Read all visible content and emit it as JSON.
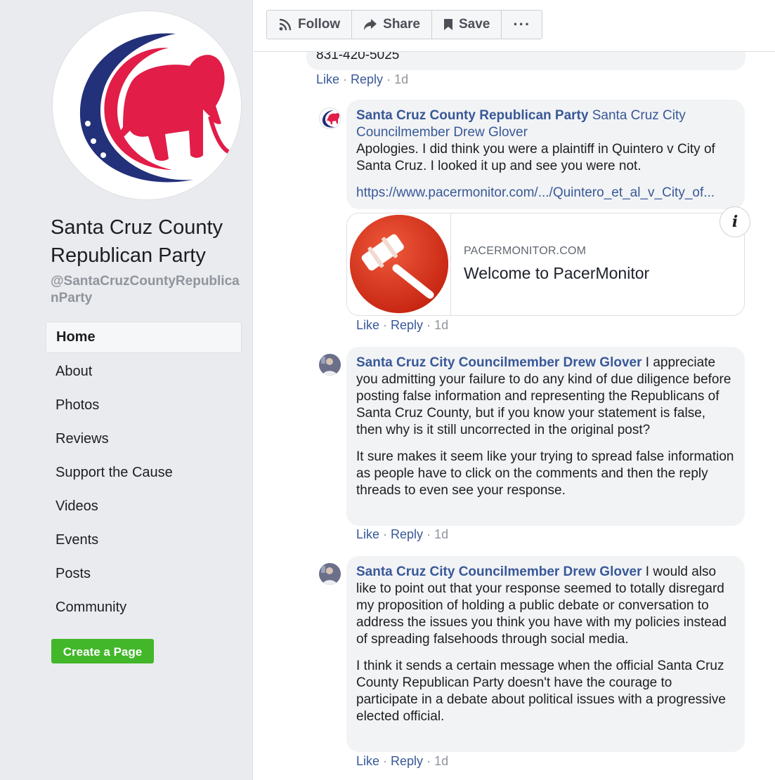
{
  "sidebar": {
    "page_name": "Santa Cruz County Republican Party",
    "page_handle": "@SantaCruzCountyRepublicanParty",
    "nav": [
      {
        "label": "Home",
        "active": true
      },
      {
        "label": "About"
      },
      {
        "label": "Photos"
      },
      {
        "label": "Reviews"
      },
      {
        "label": "Support the Cause"
      },
      {
        "label": "Videos"
      },
      {
        "label": "Events"
      },
      {
        "label": "Posts"
      },
      {
        "label": "Community"
      }
    ],
    "create_page_label": "Create a Page"
  },
  "toolbar": {
    "follow_label": "Follow",
    "share_label": "Share",
    "save_label": "Save",
    "more_label": "···"
  },
  "previous_comment": {
    "text_fragment": "831-420-5025",
    "like": "Like",
    "reply": "Reply",
    "time": "1d"
  },
  "comments": [
    {
      "author": "Santa Cruz County Republican Party",
      "mention": "Santa Cruz City Councilmember Drew Glover",
      "paragraphs": [
        "Apologies. I did think you were a plaintiff in Quintero v City of Santa Cruz. I looked it up and see you were not."
      ],
      "link": "https://www.pacermonitor.com/.../Quintero_et_al_v_City_of...",
      "preview": {
        "domain": "PACERMONITOR.COM",
        "title": "Welcome to PacerMonitor"
      },
      "like": "Like",
      "reply": "Reply",
      "time": "1d"
    },
    {
      "author": "Santa Cruz City Councilmember Drew Glover",
      "paragraphs": [
        "I appreciate you admitting your failure to do any kind of due diligence before posting false information and representing the Republicans of Santa Cruz County, but if you know your statement is false, then why is it still uncorrected in the original post?",
        "It sure makes it seem like your trying to spread false information as people have to click on the comments and then the reply threads to even see your response."
      ],
      "like": "Like",
      "reply": "Reply",
      "time": "1d"
    },
    {
      "author": "Santa Cruz City Councilmember Drew Glover",
      "paragraphs": [
        "I would also like to point out that your response seemed to totally disregard my proposition of holding a public debate or conversation to address the issues you think you have with my policies instead of spreading falsehoods through social media.",
        "I think it sends a certain message when the official Santa Cruz County Republican Party doesn't have the courage to participate in a debate about political issues with a progressive elected official."
      ],
      "like": "Like",
      "reply": "Reply",
      "time": "1d"
    }
  ],
  "icons": {
    "follow": "rss-icon",
    "share": "share-arrow-icon",
    "save": "bookmark-icon",
    "more": "more-dots-icon",
    "info": "info-icon"
  },
  "colors": {
    "link": "#385898",
    "create_button": "#42b72a",
    "sidebar_bg": "#e9ebee",
    "bubble_bg": "#f2f3f5"
  }
}
